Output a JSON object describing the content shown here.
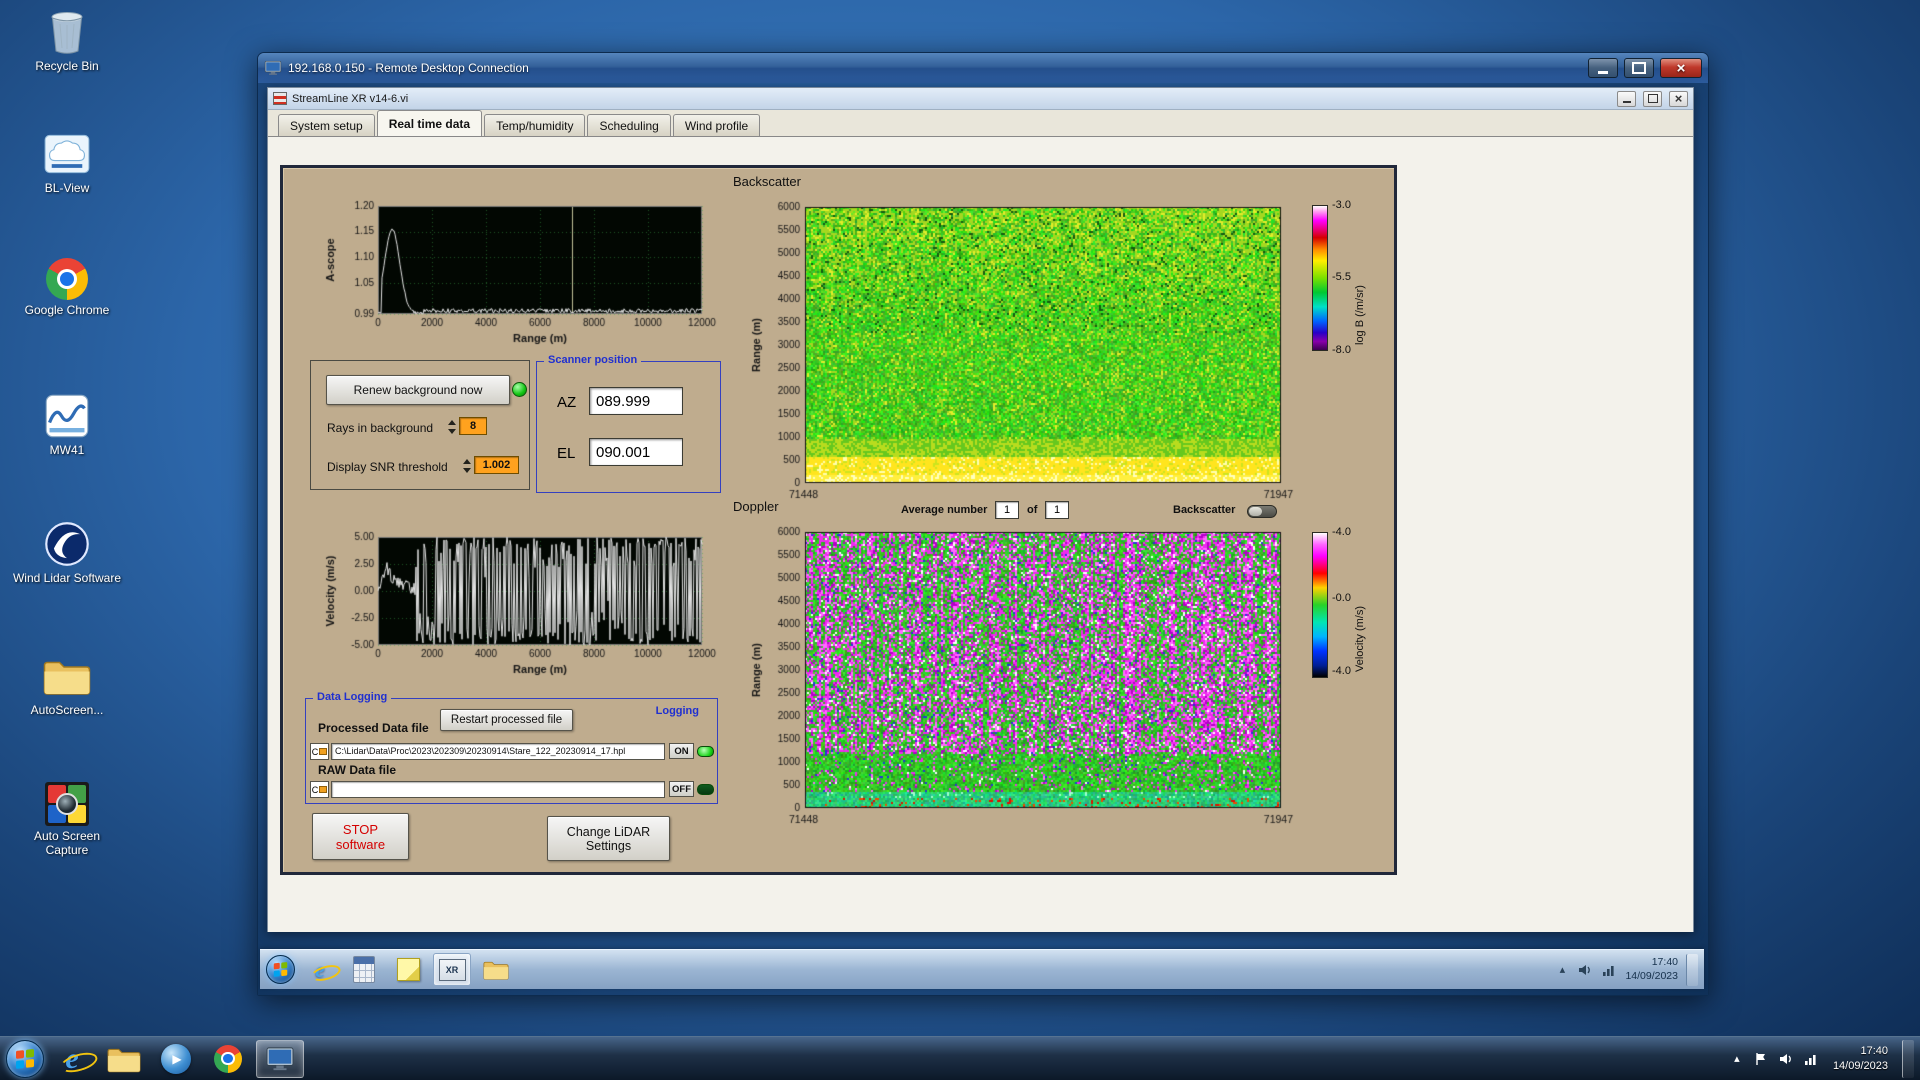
{
  "colors": {
    "panel_tan": "#bfac8e",
    "labview_blue": "#2030d0",
    "value_orange": "#ffa21e",
    "led_green": "#16d216",
    "titlebar_blue": "#336099",
    "desktop_blue": "#2c66a9"
  },
  "desktop": {
    "icons": [
      {
        "label": "Recycle Bin"
      },
      {
        "label": "BL-View"
      },
      {
        "label": "Google Chrome"
      },
      {
        "label": "MW41"
      },
      {
        "label": "Wind Lidar Software"
      },
      {
        "label": "AutoScreen..."
      },
      {
        "label": "Auto Screen Capture"
      }
    ],
    "taskbar": {
      "time": "17:40",
      "date": "14/09/2023"
    }
  },
  "rdp": {
    "title": "192.168.0.150 - Remote Desktop Connection",
    "remote_taskbar": {
      "time": "17:40",
      "date": "14/09/2023"
    }
  },
  "app": {
    "title": "StreamLine XR v14-6.vi",
    "active_tab": "Real time data",
    "tabs": [
      {
        "label": "System setup"
      },
      {
        "label": "Real time data"
      },
      {
        "label": "Temp/humidity"
      },
      {
        "label": "Scheduling"
      },
      {
        "label": "Wind profile"
      }
    ]
  },
  "panel": {
    "renew_button": "Renew background now",
    "rays_label": "Rays in background",
    "rays_value": "8",
    "snr_label": "Display SNR threshold",
    "snr_value": "1.002",
    "scanner": {
      "title": "Scanner position",
      "az_label": "AZ",
      "az_value": "089.999",
      "el_label": "EL",
      "el_value": "090.001"
    },
    "logging": {
      "title": "Data Logging",
      "processed_label": "Processed Data file",
      "restart_button": "Restart processed file",
      "logging_label": "Logging",
      "drive": "C",
      "processed_path": "C:\\Lidar\\Data\\Proc\\2023\\202309\\20230914\\Stare_122_20230914_17.hpl",
      "raw_label": "RAW Data file",
      "raw_path": "",
      "on_label": "ON",
      "off_label": "OFF"
    },
    "stop_button": "STOP software",
    "change_button": "Change LiDAR Settings",
    "average": {
      "label": "Average number",
      "value": "1",
      "of_label": "of",
      "count": "1",
      "toggle_label": "Backscatter"
    }
  },
  "chart_data": [
    {
      "type": "line",
      "name": "a_scope",
      "ylabel": "A-scope",
      "xlabel": "Range (m)",
      "yticks": [
        "1.20",
        "1.15",
        "1.10",
        "1.05",
        "0.99"
      ],
      "ylim": [
        0.99,
        1.2
      ],
      "xticks": [
        0,
        2000,
        4000,
        6000,
        8000,
        10000,
        12000
      ],
      "xlim": [
        0,
        12000
      ],
      "grid": true,
      "description": "Background SNR trace: peak ~1.15 near 500 m decaying to ~1.0, noisy flat tail to 12000 m, vertical cursor near 7200 m"
    },
    {
      "type": "heatmap",
      "name": "backscatter",
      "title": "Backscatter",
      "ylabel": "Range (m)",
      "yticks": [
        6000,
        5500,
        5000,
        4500,
        4000,
        3500,
        3000,
        2500,
        2000,
        1500,
        1000,
        500,
        0
      ],
      "ylim": [
        0,
        6000
      ],
      "xticks": [
        71448,
        71947
      ],
      "colorbar": {
        "label": "log B (/m/sr)",
        "ticks": [
          "-3.0",
          "-5.5",
          "-8.0"
        ]
      },
      "description": "Attenuated backscatter time-height plot: mostly green (~-5.5), yellow-green speckle aloft, bright yellow band below ~500 m"
    },
    {
      "type": "line",
      "name": "velocity",
      "ylabel": "Velocity (m/s)",
      "xlabel": "Range (m)",
      "yticks": [
        "5.00",
        "2.50",
        "0.00",
        "-2.50",
        "-5.00"
      ],
      "ylim": [
        -5,
        5
      ],
      "xticks": [
        0,
        2000,
        4000,
        6000,
        8000,
        10000,
        12000
      ],
      "xlim": [
        0,
        12000
      ],
      "grid": true,
      "description": "Radial velocity trace: ~+2 m/s spike near 300 m then dense noise spanning ±5 m/s beyond ~1500 m"
    },
    {
      "type": "heatmap",
      "name": "doppler",
      "title": "Doppler",
      "ylabel": "Range (m)",
      "yticks": [
        6000,
        5500,
        5000,
        4500,
        4000,
        3500,
        3000,
        2500,
        2000,
        1500,
        1000,
        500,
        0
      ],
      "ylim": [
        0,
        6000
      ],
      "xticks": [
        71448,
        71947
      ],
      "colorbar": {
        "label": "Velocity (m/s)",
        "ticks": [
          "-4.0",
          "-0.0",
          "-4.0"
        ]
      },
      "description": "Doppler velocity time-height plot: noisy magenta/green speckle aloft, smooth green-teal boundary layer below ~1000 m with red patches near ground"
    }
  ]
}
